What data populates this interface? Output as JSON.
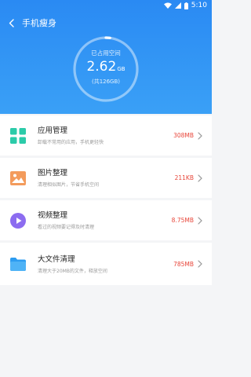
{
  "status_bar": {
    "time": "5:10"
  },
  "header": {
    "title": "手机瘦身",
    "back_icon": "back-arrow-icon"
  },
  "storage": {
    "label": "已占用空间",
    "used_value": "2.62",
    "used_unit": "GB",
    "total": "(共126GB)",
    "used_fraction": 0.021
  },
  "items": [
    {
      "name": "应用管理",
      "desc": "卸载不常用的应用，手机更轻快",
      "size": "308MB",
      "icon": "apps-grid-icon"
    },
    {
      "name": "图片整理",
      "desc": "清理相似图片，节省手机空间",
      "size": "211KB",
      "icon": "image-icon"
    },
    {
      "name": "视频整理",
      "desc": "看过的视频要记得及时清理",
      "size": "8.75MB",
      "icon": "video-play-icon"
    },
    {
      "name": "大文件清理",
      "desc": "清理大于20MB的文件，释放空间",
      "size": "785MB",
      "icon": "folder-icon"
    }
  ],
  "colors": {
    "header_blue": "#2a8af3",
    "size_red": "#e8463a"
  }
}
